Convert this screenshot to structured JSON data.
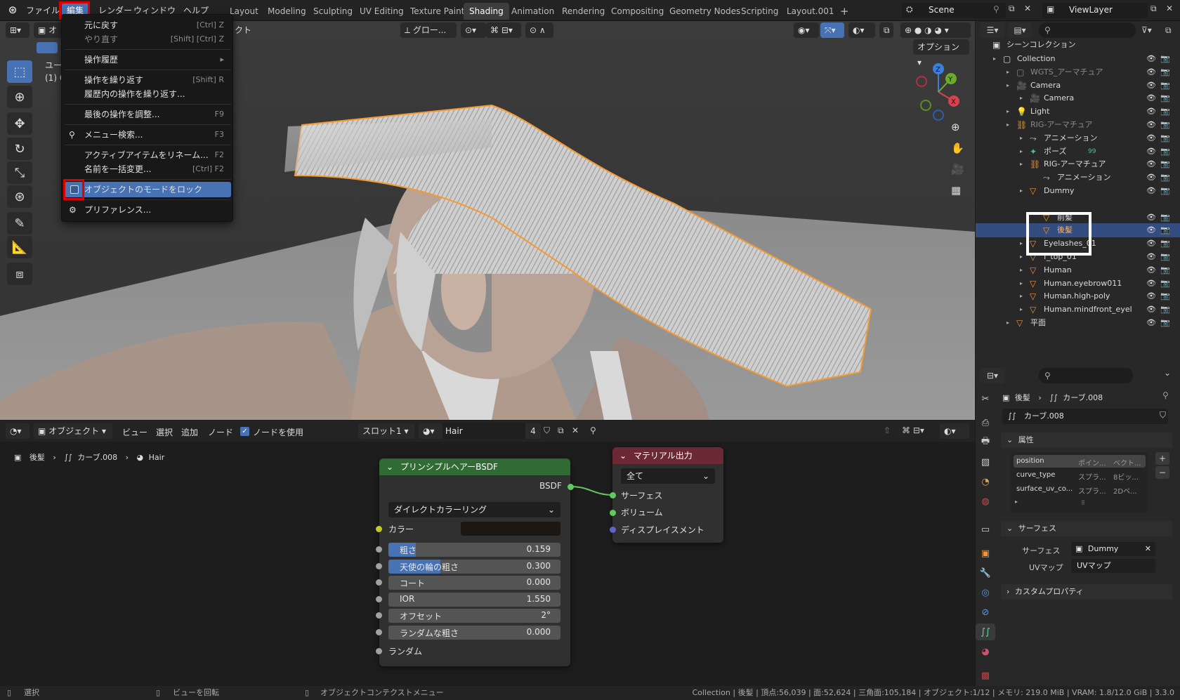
{
  "topbar": {
    "menus": [
      "ファイル",
      "編集",
      "レンダー",
      "ウィンドウ",
      "ヘルプ"
    ],
    "workspaces": [
      "Layout",
      "Modeling",
      "Sculpting",
      "UV Editing",
      "Texture Paint",
      "Shading",
      "Animation",
      "Rendering",
      "Compositing",
      "Geometry Nodes",
      "Scripting",
      "Layout.001"
    ],
    "active_workspace": "Shading",
    "scene": "Scene",
    "view_layer": "ViewLayer",
    "add_tab": "+"
  },
  "edit_menu": {
    "items": [
      {
        "label": "元に戻す",
        "shortcut": "[Ctrl] Z"
      },
      {
        "label": "やり直す",
        "shortcut": "[Shift] [Ctrl] Z"
      },
      {
        "label": "操作履歴",
        "shortcut": "▸"
      },
      {
        "label": "操作を繰り返す",
        "shortcut": "[Shift] R"
      },
      {
        "label": "履歴内の操作を繰り返す...",
        "shortcut": ""
      },
      {
        "label": "最後の操作を調整...",
        "shortcut": "F9"
      },
      {
        "label": "メニュー検索...",
        "shortcut": "F3"
      },
      {
        "label": "アクティブアイテムをリネーム...",
        "shortcut": "F2"
      },
      {
        "label": "名前を一括変更...",
        "shortcut": "[Ctrl] F2"
      },
      {
        "label": "オブジェクトのモードをロック",
        "shortcut": ""
      },
      {
        "label": "プリファレンス...",
        "shortcut": ""
      }
    ]
  },
  "viewport": {
    "header_mode": "オ",
    "header_partial": "クト",
    "transform": "グロー...",
    "options": "オプション",
    "overlay_text_1": "ユー",
    "overlay_text_2": "(1) C"
  },
  "outliner": {
    "scene_collection": "シーンコレクション",
    "rows": [
      {
        "name": "Collection",
        "indent": 1
      },
      {
        "name": "WGTS_アーマチュア",
        "indent": 2,
        "dim": true
      },
      {
        "name": "Camera",
        "indent": 2
      },
      {
        "name": "Camera",
        "indent": 3
      },
      {
        "name": "Light",
        "indent": 2
      },
      {
        "name": "RIG-アーマチュア",
        "indent": 2,
        "dim": true
      },
      {
        "name": "アニメーション",
        "indent": 3
      },
      {
        "name": "ポーズ",
        "indent": 3
      },
      {
        "name": "RIG-アーマチュア",
        "indent": 3
      },
      {
        "name": "アニメーション",
        "indent": 4
      },
      {
        "name": "Dummy",
        "indent": 3
      },
      {
        "name": "",
        "indent": 4
      },
      {
        "name": "前髪",
        "indent": 4
      },
      {
        "name": "後髪",
        "indent": 4,
        "selected": true
      },
      {
        "name": "Eyelashes_01",
        "indent": 3
      },
      {
        "name": "f_top_01",
        "indent": 3
      },
      {
        "name": "Human",
        "indent": 3
      },
      {
        "name": "Human.eyebrow011",
        "indent": 3
      },
      {
        "name": "Human.high-poly",
        "indent": 3
      },
      {
        "name": "Human.mindfront_eyel",
        "indent": 3
      },
      {
        "name": "平面",
        "indent": 2
      }
    ],
    "pose_badge": "99"
  },
  "properties": {
    "breadcrumb_obj": "後髪",
    "breadcrumb_data": "カーブ.008",
    "data_name": "カーブ.008",
    "attributes_title": "属性",
    "attributes": [
      {
        "name": "position",
        "domain": "ポイン...",
        "type": "ベクト..."
      },
      {
        "name": "curve_type",
        "domain": "スプラ...",
        "type": "8ビッ..."
      },
      {
        "name": "surface_uv_co...",
        "domain": "スプラ...",
        "type": "2Dベ..."
      }
    ],
    "surface_title": "サーフェス",
    "surface_label": "サーフェス",
    "surface_value": "Dummy",
    "uvmap_label": "UVマップ",
    "uvmap_value": "UVマップ",
    "custom_props": "カスタムプロパティ"
  },
  "node_editor": {
    "header": {
      "mode": "オブジェクト",
      "view": "ビュー",
      "select": "選択",
      "add": "追加",
      "node": "ノード",
      "use_nodes": "ノードを使用",
      "slot": "スロット1",
      "material": "Hair",
      "users": "4"
    },
    "breadcrumb": [
      "後髪",
      "カーブ.008",
      "Hair"
    ],
    "hair_node": {
      "title": "プリンシプルヘアーBSDF",
      "output": "BSDF",
      "mode": "ダイレクトカラーリング",
      "color_label": "カラー",
      "sliders": [
        {
          "label": "粗さ",
          "value": "0.159",
          "fill": 0.159
        },
        {
          "label": "天使の輪の粗さ",
          "value": "0.300",
          "fill": 0.3
        },
        {
          "label": "コート",
          "value": "0.000",
          "fill": 0
        },
        {
          "label": "IOR",
          "value": "1.550",
          "fill": 0
        },
        {
          "label": "オフセット",
          "value": "2°",
          "fill": 0
        },
        {
          "label": "ランダムな粗さ",
          "value": "0.000",
          "fill": 0
        }
      ],
      "random": "ランダム"
    },
    "output_node": {
      "title": "マテリアル出力",
      "target": "全て",
      "inputs": [
        "サーフェス",
        "ボリューム",
        "ディスプレイスメント"
      ]
    }
  },
  "statusbar": {
    "select": "選択",
    "rotate": "ビューを回転",
    "context": "オブジェクトコンテクストメニュー",
    "stats": "Collection | 後髪 | 頂点:56,039 | 面:52,624 | 三角面:105,184 | オブジェクト:1/12 | メモリ: 219.0 MiB | VRAM: 1.8/12.0 GiB | 3.3.0"
  },
  "colors": {
    "accent": "#4772b3",
    "highlight_red": "#e00000",
    "hair_node_header": "#2f6b33",
    "output_node_header": "#6b2a33",
    "orange_outline": "#f59a32"
  }
}
